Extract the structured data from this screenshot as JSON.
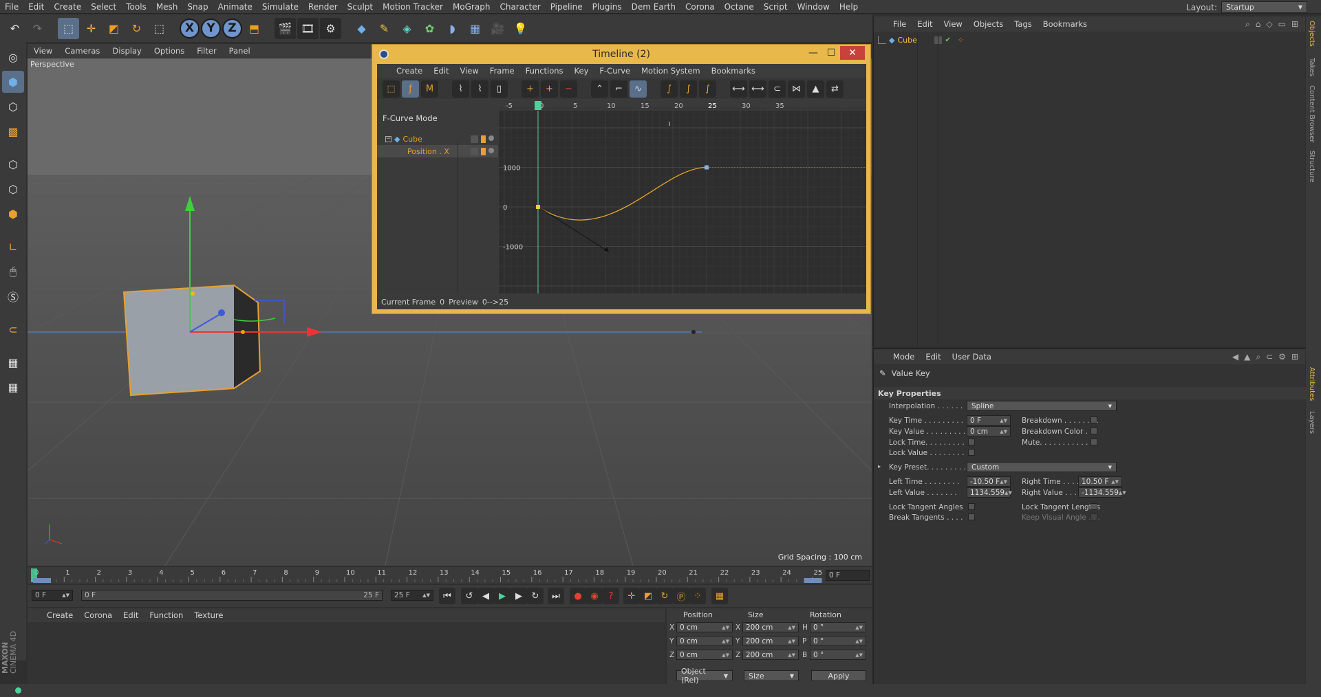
{
  "menubar": {
    "items": [
      "File",
      "Edit",
      "Create",
      "Select",
      "Tools",
      "Mesh",
      "Snap",
      "Animate",
      "Simulate",
      "Render",
      "Sculpt",
      "Motion Tracker",
      "MoGraph",
      "Character",
      "Pipeline",
      "Plugins",
      "Dem Earth",
      "Corona",
      "Octane",
      "Script",
      "Window",
      "Help"
    ],
    "layout_label": "Layout:",
    "layout_value": "Startup"
  },
  "maintoolbar": {
    "axis_x": "X",
    "axis_y": "Y",
    "axis_z": "Z"
  },
  "viewport": {
    "menu": [
      "View",
      "Cameras",
      "Display",
      "Options",
      "Filter",
      "Panel"
    ],
    "label": "Perspective",
    "grid_spacing": "Grid Spacing : 100 cm"
  },
  "timeline": {
    "title": "Timeline (2)",
    "menu": [
      "Create",
      "Edit",
      "View",
      "Frame",
      "Functions",
      "Key",
      "F-Curve",
      "Motion System",
      "Bookmarks"
    ],
    "mode": "F-Curve Mode",
    "tree": {
      "object": "Cube",
      "track": "Position . X"
    },
    "graph": {
      "x_ticks": [
        "-5",
        "0",
        "5",
        "10",
        "15",
        "20",
        "25",
        "30",
        "35"
      ],
      "y_ticks": [
        "1000",
        "0",
        "-1000"
      ],
      "current_frame_marker": "0"
    },
    "status": {
      "current_frame_label": "Current Frame",
      "current_frame": "0",
      "preview_label": "Preview",
      "preview": "0-->25"
    }
  },
  "object_manager": {
    "menu": [
      "File",
      "Edit",
      "View",
      "Objects",
      "Tags",
      "Bookmarks"
    ],
    "object_name": "Cube"
  },
  "side_tabs": [
    "Objects",
    "Takes",
    "Content Browser",
    "Structure"
  ],
  "side_tabs_lower": [
    "Attributes",
    "Layers"
  ],
  "attributes": {
    "menu": [
      "Mode",
      "Edit",
      "User Data"
    ],
    "title": "Value Key",
    "section": "Key Properties",
    "interpolation_label": "Interpolation . . . . . .",
    "interpolation": "Spline",
    "key_time_label": "Key Time . . . . . . . . .",
    "key_time": "0 F",
    "key_value_label": "Key Value . . . . . . . . .",
    "key_value": "0 cm",
    "lock_time_label": "Lock Time. . . . . . . . .",
    "lock_value_label": "Lock Value . . . . . . . .",
    "breakdown_label": "Breakdown . . . . . . . .",
    "breakdown_color_label": "Breakdown Color . . .",
    "mute_label": "Mute. . . . . . . . . . . . .",
    "key_preset_label": "Key Preset. . . . . . . . .",
    "key_preset": "Custom",
    "left_time_label": "Left  Time . . . . . . . .",
    "left_time": "-10.50 F",
    "left_value_label": "Left  Value . . . . . . .",
    "left_value": "1134.559",
    "right_time_label": "Right Time . . . . . . .",
    "right_time": "10.50 F",
    "right_value_label": "Right Value . . . . . .",
    "right_value": "-1134.559",
    "lock_tangent_angles_label": "Lock Tangent Angles",
    "lock_tangent_lengths_label": "Lock Tangent Lengths",
    "break_tangents_label": "Break Tangents . . . .",
    "keep_visual_angle_label": "Keep Visual Angle . . ."
  },
  "time_ruler": {
    "ticks": [
      "0",
      "1",
      "2",
      "3",
      "4",
      "5",
      "6",
      "7",
      "8",
      "9",
      "10",
      "11",
      "12",
      "13",
      "14",
      "15",
      "16",
      "17",
      "18",
      "19",
      "20",
      "21",
      "22",
      "23",
      "24",
      "25"
    ],
    "frame_field": "0 F"
  },
  "transport": {
    "start": "0 F",
    "range_start": "0 F",
    "range_end": "25 F",
    "end": "25 F"
  },
  "material_manager": {
    "menu": [
      "Create",
      "Corona",
      "Edit",
      "Function",
      "Texture"
    ]
  },
  "coordinates": {
    "headers": [
      "Position",
      "Size",
      "Rotation"
    ],
    "rows": [
      {
        "axis": "X",
        "pos": "0 cm",
        "size_axis": "X",
        "size": "200 cm",
        "rot_axis": "H",
        "rot": "0 °"
      },
      {
        "axis": "Y",
        "pos": "0 cm",
        "size_axis": "Y",
        "size": "200 cm",
        "rot_axis": "P",
        "rot": "0 °"
      },
      {
        "axis": "Z",
        "pos": "0 cm",
        "size_axis": "Z",
        "size": "200 cm",
        "rot_axis": "B",
        "rot": "0 °"
      }
    ],
    "mode_dropdown": "Object (Rel)",
    "size_dropdown": "Size",
    "apply_label": "Apply"
  },
  "brand": {
    "line1": "MAXON",
    "line2": "CINEMA 4D"
  },
  "colors": {
    "accent_orange": "#e8b84a",
    "selection_blue": "#5a6f8a",
    "curve": "#e8a72e",
    "marker_green": "#4ad39a"
  }
}
